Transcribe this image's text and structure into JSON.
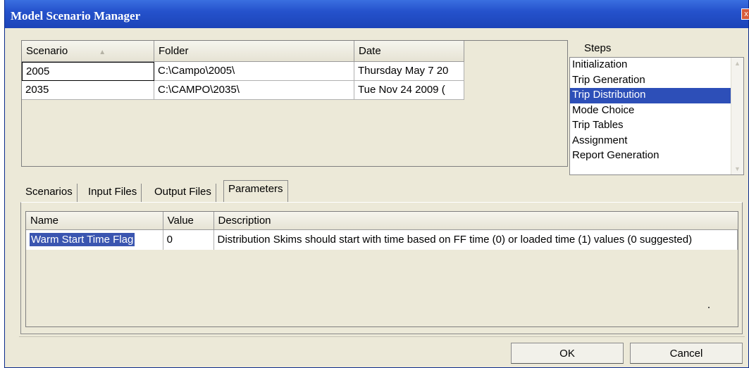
{
  "window": {
    "title": "Model Scenario Manager",
    "close_glyph": "x"
  },
  "scenario_grid": {
    "columns": [
      "Scenario",
      "Folder",
      "Date"
    ],
    "rows": [
      [
        "2005",
        "C:\\Campo\\2005\\",
        "Thursday May 7 20"
      ],
      [
        "2035",
        "C:\\CAMPO\\2035\\",
        "Tue Nov 24 2009 ("
      ]
    ]
  },
  "steps": {
    "label": "Steps",
    "items": [
      "Initialization",
      "Trip Generation",
      "Trip Distribution",
      "Mode Choice",
      "Trip Tables",
      "Assignment",
      "Report Generation"
    ],
    "selected": "Trip Distribution"
  },
  "tabs": {
    "scenarios": "Scenarios",
    "input_files": "Input Files",
    "output_files": "Output Files",
    "parameters": "Parameters"
  },
  "parameters": {
    "columns": [
      "Name",
      "Value",
      "Description"
    ],
    "rows": [
      [
        "Warm Start Time Flag",
        "0",
        "Distribution Skims should start with time based on FF time (0) or loaded time (1) values (0 suggested)"
      ]
    ]
  },
  "buttons": {
    "ok": "OK",
    "cancel": "Cancel"
  },
  "colors": {
    "titlebar": "#2552cc",
    "selection": "#2d4fb8",
    "dialog_bg": "#ece9d8"
  }
}
